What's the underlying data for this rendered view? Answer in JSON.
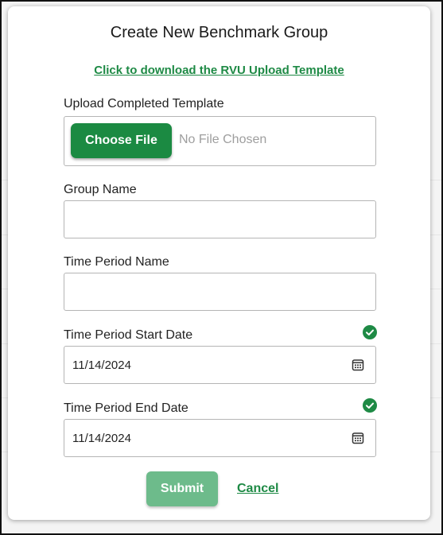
{
  "modal": {
    "title": "Create New Benchmark Group",
    "download_link": "Click to download the RVU Upload Template"
  },
  "upload": {
    "label": "Upload Completed Template",
    "button_label": "Choose File",
    "status": "No File Chosen"
  },
  "group_name": {
    "label": "Group Name",
    "value": ""
  },
  "time_period_name": {
    "label": "Time Period Name",
    "value": ""
  },
  "start_date": {
    "label": "Time Period Start Date",
    "value": "11/14/2024",
    "valid": true
  },
  "end_date": {
    "label": "Time Period End Date",
    "value": "11/14/2024",
    "valid": true
  },
  "actions": {
    "submit_label": "Submit",
    "cancel_label": "Cancel"
  },
  "icons": {
    "calendar": "calendar-icon",
    "valid": "check-circle-icon"
  },
  "colors": {
    "primary_green": "#1b8a42",
    "link_green": "#1e8a45",
    "submit_disabled_green": "#6dbb8b",
    "check_green": "#1e8a45"
  }
}
